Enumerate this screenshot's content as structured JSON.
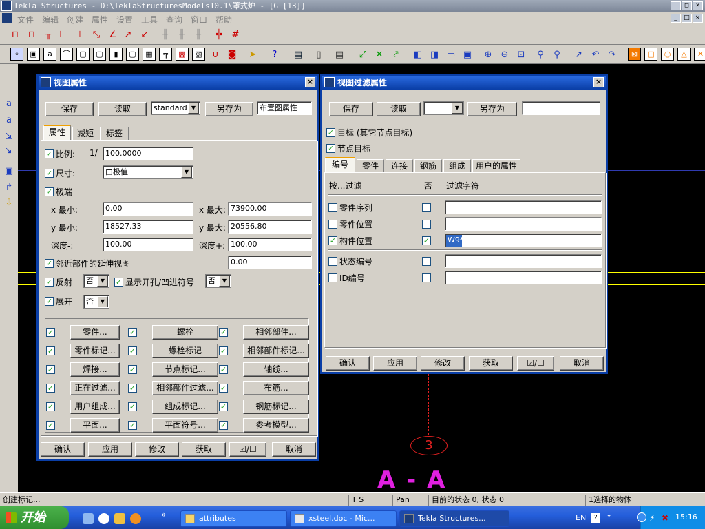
{
  "app": {
    "title": "Tekla Structures - D:\\TeklaStructuresModels10.1\\罩式炉 - [G    [13]]",
    "window_buttons": [
      "_",
      "□",
      "×"
    ]
  },
  "menu": [
    "文件",
    "编辑",
    "创建",
    "属性",
    "设置",
    "工具",
    "查询",
    "窗口",
    "帮助"
  ],
  "toolbar2_right": {
    "lines_letters": [
      "A",
      "B"
    ]
  },
  "viewport": {
    "section_label": "A - A",
    "grid_label": "3"
  },
  "view_props": {
    "title": "视图属性",
    "save": "保存",
    "read": "读取",
    "preset": "standard",
    "save_as": "另存为",
    "preset_name": "布置图属性",
    "tabs": [
      "属性",
      "减短",
      "标签"
    ],
    "scale_label": "比例:",
    "scale_prefix": "1/",
    "scale_value": "100.0000",
    "size_label": "尺寸:",
    "size_value": "由极值",
    "extrema_label": "极端",
    "xmin_label": "x 最小:",
    "xmin": "0.00",
    "xmax_label": "x 最大:",
    "xmax": "73900.00",
    "ymin_label": "y 最小:",
    "ymin": "18527.33",
    "ymax_label": "y 最大:",
    "ymax": "20556.80",
    "depth_minus_label": "深度-:",
    "depth_minus": "100.00",
    "depth_plus_label": "深度+:",
    "depth_plus": "100.00",
    "adjacent_label": "邻近部件的延伸视图",
    "adjacent_value": "0.00",
    "mirror_label": "反射",
    "mirror_value": "否",
    "show_holes_label": "显示开孔/凹进符号",
    "show_holes_value": "否",
    "unfold_label": "展开",
    "unfold_value": "否",
    "grid_buttons": [
      [
        "零件...",
        "螺栓",
        "相邻部件..."
      ],
      [
        "零件标记...",
        "螺栓标记",
        "相邻部件标记..."
      ],
      [
        "焊接...",
        "节点标记...",
        "轴线..."
      ],
      [
        "正在过滤...",
        "相邻部件过滤...",
        "布筋..."
      ],
      [
        "用户组成...",
        "组成标记...",
        "钢筋标记..."
      ],
      [
        "平面...",
        "平面符号...",
        "参考模型..."
      ]
    ],
    "footer": [
      "确认",
      "应用",
      "修改",
      "获取",
      "☑/☐",
      "取消"
    ]
  },
  "filter_props": {
    "title": "视图过滤属性",
    "save": "保存",
    "read": "读取",
    "preset": "",
    "save_as": "另存为",
    "preset_name": "",
    "target_label": "目标 (其它节点目标)",
    "node_target_label": "节点目标",
    "tabs": [
      "编号",
      "零件",
      "连接",
      "钢筋",
      "组成",
      "用户的属性"
    ],
    "col_filter": "按...过滤",
    "col_not": "否",
    "col_string": "过滤字符",
    "rows": [
      {
        "label": "零件序列",
        "checked": false,
        "not": false,
        "value": ""
      },
      {
        "label": "零件位置",
        "checked": false,
        "not": false,
        "value": ""
      },
      {
        "label": "构件位置",
        "checked": true,
        "not": true,
        "value": "W9*"
      },
      {
        "label": "状态编号",
        "checked": false,
        "not": false,
        "value": ""
      },
      {
        "label": "ID编号",
        "checked": false,
        "not": false,
        "value": ""
      }
    ],
    "footer": [
      "确认",
      "应用",
      "修改",
      "获取",
      "☑/☐",
      "取消"
    ]
  },
  "status": {
    "hint": "创建标记...",
    "ts": "T S",
    "pan": "Pan",
    "state": "目前的状态 0, 状态 0",
    "selection": "1选择的物体"
  },
  "taskbar": {
    "start": "开始",
    "tasks": [
      "attributes",
      "xsteel.doc - Mic...",
      "Tekla Structures..."
    ],
    "lang": "EN",
    "clock": "15:16"
  },
  "colors": {
    "title_blue": "#0a3ea6",
    "grid_blue": "#2f3ab0",
    "grid_yellow": "#ffff00",
    "section_magenta": "#e020e0",
    "grid_red": "#e02020"
  }
}
